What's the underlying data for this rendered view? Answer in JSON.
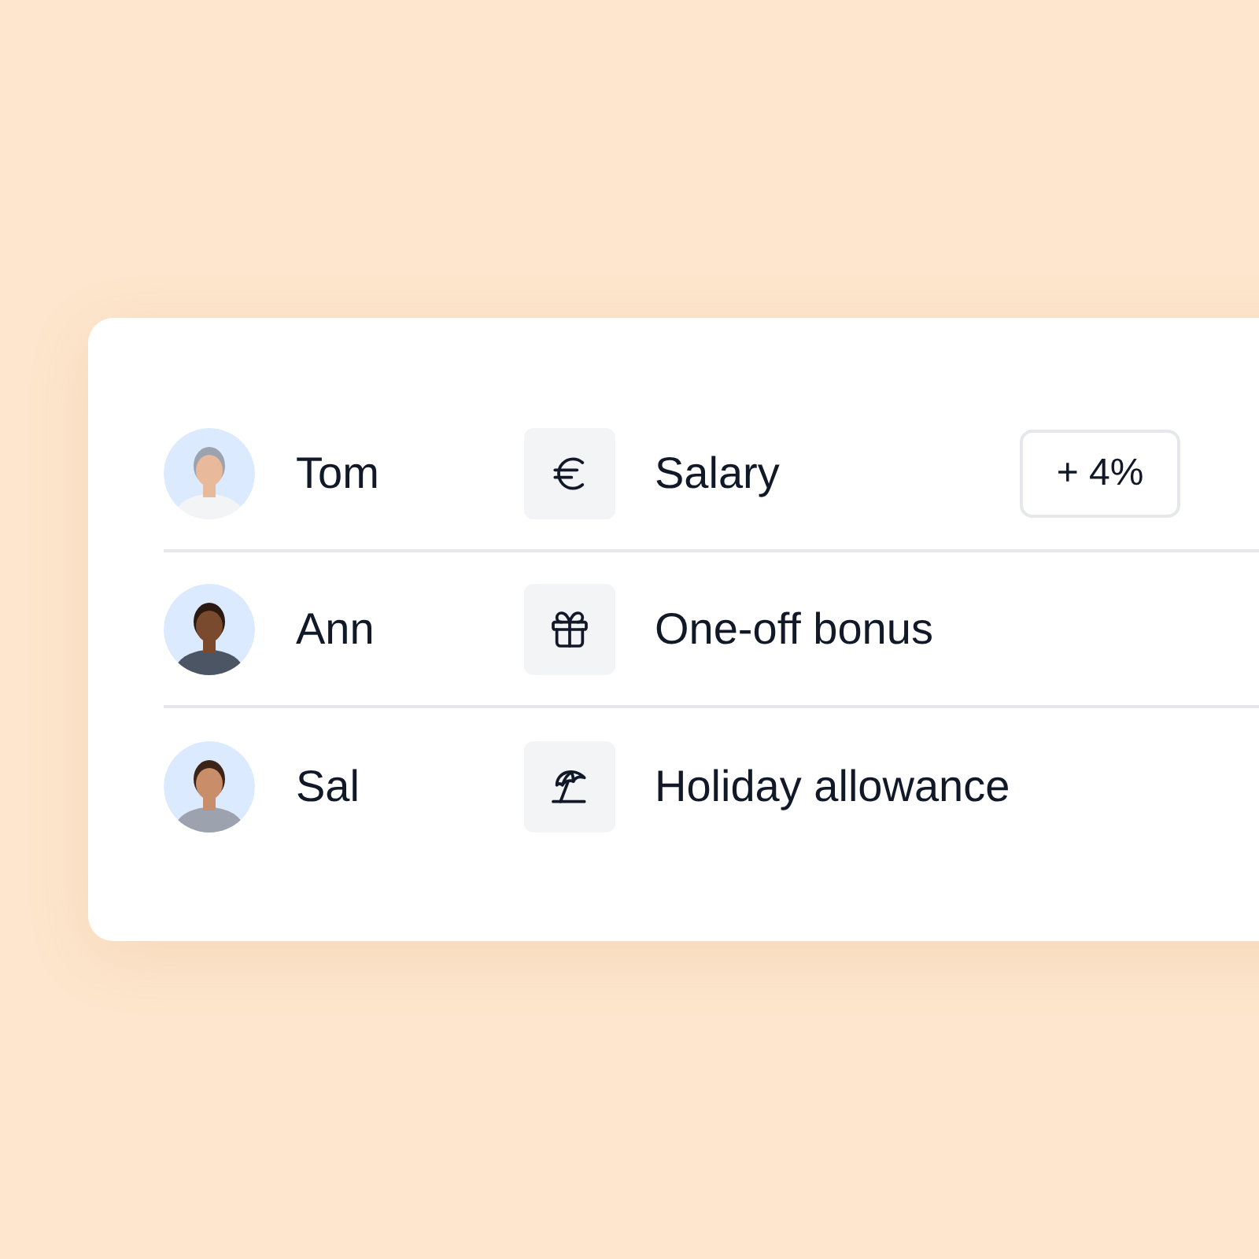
{
  "rows": [
    {
      "name": "Tom",
      "benefit": {
        "kind": "euro",
        "label": "Salary"
      },
      "badge": "+ 4%"
    },
    {
      "name": "Ann",
      "benefit": {
        "kind": "gift",
        "label": "One-off bonus"
      }
    },
    {
      "name": "Sal",
      "benefit": {
        "kind": "umbrella",
        "label": "Holiday allowance"
      }
    }
  ]
}
